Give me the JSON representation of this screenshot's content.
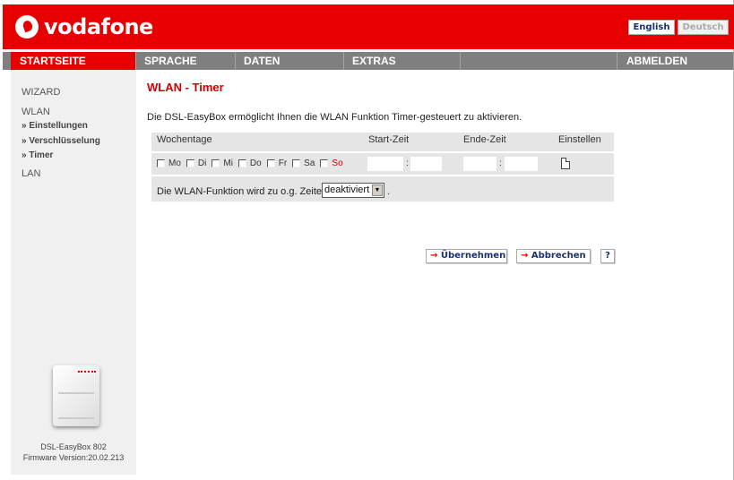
{
  "header": {
    "brand": "vodafone",
    "lang_en": "English",
    "lang_de": "Deutsch"
  },
  "nav": {
    "items": [
      {
        "label": "STARTSEITE"
      },
      {
        "label": "SPRACHE"
      },
      {
        "label": "DATEN"
      },
      {
        "label": "EXTRAS"
      },
      {
        "label": ""
      },
      {
        "label": "ABMELDEN"
      }
    ]
  },
  "sidebar": {
    "wizard": "WIZARD",
    "wlan": "WLAN",
    "einstellungen": "» Einstellungen",
    "verschluesselung": "» Verschlüsselung",
    "timer": "» Timer",
    "lan": "LAN",
    "device_name": "DSL-EasyBox 802",
    "firmware": "Firmware Version:20.02.213"
  },
  "main": {
    "title": "WLAN - Timer",
    "description": "Die DSL-EasyBox ermöglicht Ihnen die WLAN Funktion Timer-gesteuert zu aktivieren.",
    "table": {
      "headers": [
        "Wochentage",
        "Start-Zeit",
        "Ende-Zeit",
        "Einstellen"
      ],
      "days": [
        "Mo",
        "Di",
        "Mi",
        "Do",
        "Fr",
        "Sa",
        "So"
      ],
      "start_colon": ":",
      "end_colon": ":"
    },
    "function_label": "Die WLAN-Funktion wird zu o.g. Zeiten",
    "function_select": "deaktiviert",
    "function_suffix": ".",
    "buttons": {
      "apply": "Übernehmen",
      "cancel": "Abbrechen",
      "help": "?"
    }
  },
  "colors": {
    "brand_red": "#e60000",
    "nav_gray": "#7f7f7f",
    "sidebar_bg": "#f0f0f0",
    "table_bg": "#e5e5e5",
    "button_text": "#1a2f6e"
  }
}
